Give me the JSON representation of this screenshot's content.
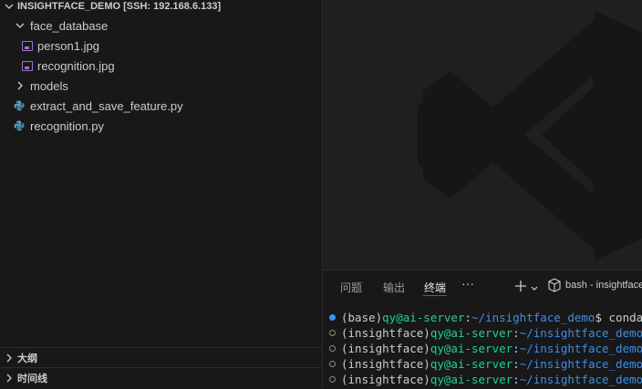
{
  "explorer": {
    "root_label": "INSIGHTFACE_DEMO [SSH: 192.168.6.133]",
    "items": [
      {
        "label": "face_database",
        "type": "folder"
      },
      {
        "label": "person1.jpg",
        "type": "image"
      },
      {
        "label": "recognition.jpg",
        "type": "image"
      },
      {
        "label": "models",
        "type": "folder"
      },
      {
        "label": "extract_and_save_feature.py",
        "type": "python"
      },
      {
        "label": "recognition.py",
        "type": "python"
      }
    ],
    "outline_label": "大纲",
    "timeline_label": "时间线"
  },
  "panel": {
    "tabs": [
      "问题",
      "输出",
      "终端"
    ],
    "active_tab": "终端",
    "more_label": "···",
    "add_label": "+",
    "terminal_name": "bash - insightface"
  },
  "terminal": {
    "lines": [
      {
        "env": "(base)",
        "user": "qy@ai-server",
        "sep": ":",
        "path": "~/insightface_demo",
        "prompt": "$",
        "cmd": " conda a"
      },
      {
        "env": "(insightface)",
        "user": "qy@ai-server",
        "sep": ":",
        "path": "~/insightface_demo",
        "prompt": "$",
        "cmd": ""
      },
      {
        "env": "(insightface)",
        "user": "qy@ai-server",
        "sep": ":",
        "path": "~/insightface_demo",
        "prompt": "$",
        "cmd": ""
      },
      {
        "env": "(insightface)",
        "user": "qy@ai-server",
        "sep": ":",
        "path": "~/insightface_demo",
        "prompt": "$",
        "cmd": ""
      },
      {
        "env": "(insightface)",
        "user": "qy@ai-server",
        "sep": ":",
        "path": "~/insightface_demo",
        "prompt": "$",
        "cmd": ""
      }
    ]
  },
  "colors": {
    "accent": "#0078d4",
    "terminal_user": "#23d18b",
    "terminal_path": "#3b8eea",
    "image_icon": "#a074c4",
    "python_icon": "#519aba"
  }
}
